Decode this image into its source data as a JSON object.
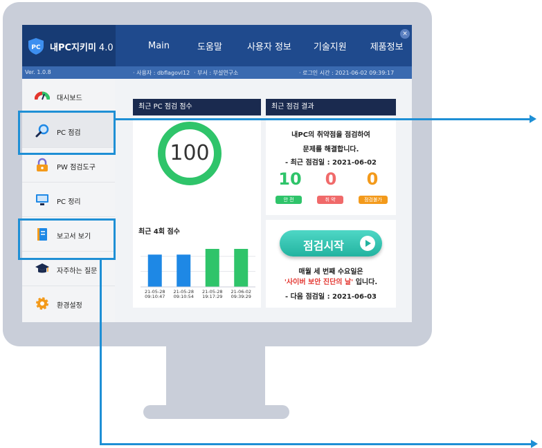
{
  "app": {
    "logo_badge": "PC",
    "name": "내PC지키미",
    "version_number": "4.0",
    "close_glyph": "×"
  },
  "nav": [
    "Main",
    "도움말",
    "사용자 정보",
    "기술지원",
    "제품정보"
  ],
  "infobar": {
    "version": "Ver. 1.0.8",
    "user": "· 사용자 : dbflagovl12",
    "dept": "· 부서 : 부설연구소",
    "login": "· 로그인 시간 : 2021-06-02 09:39:17"
  },
  "sidebar": [
    {
      "label": "대시보드",
      "icon": "dashboard-gauge-icon"
    },
    {
      "label": "PC 점검",
      "icon": "magnifier-icon"
    },
    {
      "label": "PW 점검도구",
      "icon": "lock-icon"
    },
    {
      "label": "PC 정리",
      "icon": "monitor-icon"
    },
    {
      "label": "보고서 보기",
      "icon": "report-icon"
    },
    {
      "label": "자주하는 질문",
      "icon": "graduation-cap-icon"
    },
    {
      "label": "환경설정",
      "icon": "gear-icon"
    }
  ],
  "score_panel": {
    "header": "최근 PC 점검 점수",
    "score": "100",
    "recent_title": "최근 4회 점수"
  },
  "chart_data": {
    "type": "bar",
    "categories": [
      "21-05-28 09:10:47",
      "21-05-28 09:10:54",
      "21-05-28 19:17:29",
      "21-06-02 09:39:29"
    ],
    "values": [
      85,
      85,
      100,
      100
    ],
    "colors": [
      "#1e88e5",
      "#1e88e5",
      "#2fc46a",
      "#2fc46a"
    ],
    "ylim": [
      0,
      120
    ],
    "category_lines": [
      [
        "21-05-28",
        "09:10:47"
      ],
      [
        "21-05-28",
        "09:10:54"
      ],
      [
        "21-05-28",
        "19:17:29"
      ],
      [
        "21-06-02",
        "09:39:29"
      ]
    ]
  },
  "result_panel": {
    "header": "최근 점검 결과",
    "line1": "내PC의 취약점을 점검하여",
    "line2": "문제를 해결합니다.",
    "last_date": "- 최근 점검일 : 2021-06-02",
    "safe_count": "10",
    "vuln_count": "0",
    "na_count": "0",
    "safe_label": "안 전",
    "vuln_label": "취 약",
    "na_label": "점검불가",
    "safe_color": "#2fc46a",
    "vuln_color": "#f06a6a",
    "na_color": "#f39a1b"
  },
  "start_panel": {
    "button_label": "점검시작",
    "info1": "매월 세 번째 수요일은",
    "info2_red": "'사이버 보안 진단의 날'",
    "info2_rest": " 입니다.",
    "next_date": "- 다음 점검일 : 2021-06-03"
  },
  "colors": {
    "nav_bg": "#1f4a8d",
    "highlight": "#1e8fd5"
  }
}
